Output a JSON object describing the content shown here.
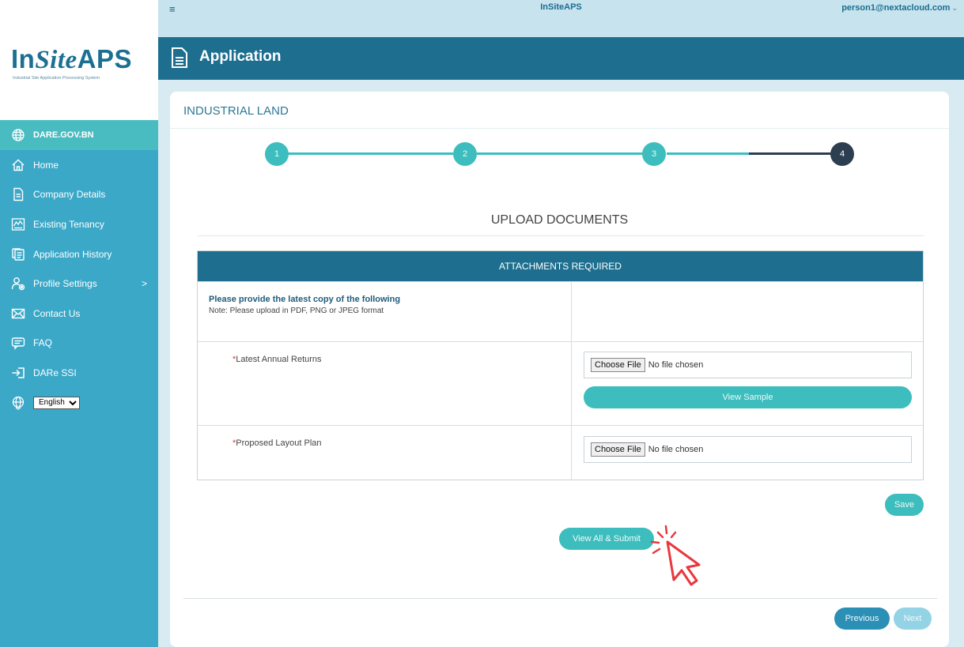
{
  "logo": {
    "brand_plain": "In",
    "brand_italic": "Site",
    "brand_bold": "APS",
    "subtitle": "Industrial Site Application Processing System"
  },
  "topbar": {
    "menu_icon": "hamburger-icon",
    "title": "InSiteAPS",
    "user": "person1@nextacloud.com",
    "caret": "⌄"
  },
  "header": {
    "icon": "document-icon",
    "title": "Application"
  },
  "sidebar": {
    "items": [
      {
        "label": "DARE.GOV.BN",
        "icon": "globe-icon"
      },
      {
        "label": "Home",
        "icon": "home-icon"
      },
      {
        "label": "Company Details",
        "icon": "document-icon"
      },
      {
        "label": "Existing Tenancy",
        "icon": "chart-icon"
      },
      {
        "label": "Application History",
        "icon": "history-icon"
      },
      {
        "label": "Profile Settings",
        "icon": "profile-icon",
        "arrow": ">"
      },
      {
        "label": "Contact Us",
        "icon": "mail-icon"
      },
      {
        "label": "FAQ",
        "icon": "faq-icon"
      },
      {
        "label": "DARe SSI",
        "icon": "exit-icon"
      }
    ],
    "language": {
      "icon": "language-globe-icon",
      "selected": "English"
    }
  },
  "card": {
    "title": "INDUSTRIAL LAND"
  },
  "stepper": {
    "steps": [
      "1",
      "2",
      "3",
      "4"
    ],
    "current": 4
  },
  "upload": {
    "title": "UPLOAD DOCUMENTS",
    "table_header": "ATTACHMENTS REQUIRED",
    "intro_bold": "Please provide the latest copy of the following",
    "intro_note": "Note: Please upload in PDF, PNG or JPEG format",
    "required_mark": "*",
    "rows": [
      {
        "label": "Latest Annual Returns",
        "file_button": "Choose File",
        "file_status": "No file chosen",
        "sample_button": "View Sample"
      },
      {
        "label": "Proposed Layout Plan",
        "file_button": "Choose File",
        "file_status": "No file chosen"
      }
    ]
  },
  "buttons": {
    "save": "Save",
    "submit": "View All & Submit",
    "previous": "Previous",
    "next": "Next"
  },
  "colors": {
    "primary_dark": "#1e6f8f",
    "teal": "#3dbdbd",
    "sidebar": "#3ba8c8",
    "active_step": "#2c3e50",
    "required": "#d9342b"
  }
}
